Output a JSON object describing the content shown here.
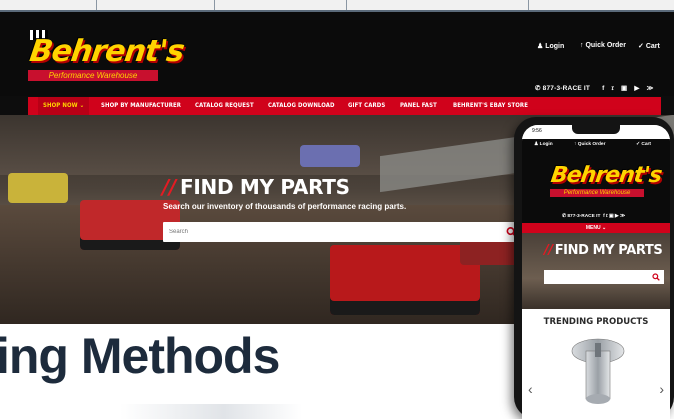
{
  "desktop": {
    "brand": {
      "name": "Behrent's",
      "tagline": "Performance Warehouse"
    },
    "util": {
      "login": "Login",
      "quick_order": "Quick Order",
      "cart": "Cart"
    },
    "phone_line": "877-3-RACE IT",
    "social_icons": [
      "facebook-icon",
      "twitter-icon",
      "instagram-icon",
      "youtube-icon",
      "rss-icon"
    ],
    "nav": [
      {
        "label": "SHOP NOW",
        "active": true
      },
      {
        "label": "SHOP BY MANUFACTURER"
      },
      {
        "label": "CATALOG REQUEST"
      },
      {
        "label": "CATALOG DOWNLOAD"
      },
      {
        "label": "GIFT CARDS"
      },
      {
        "label": "PANEL FAST"
      },
      {
        "label": "BEHRENT'S EBAY STORE"
      }
    ],
    "hero": {
      "title": "FIND MY PARTS",
      "subtitle": "Search our inventory of thousands of performance racing parts.",
      "search_placeholder": "Search"
    }
  },
  "mobile": {
    "status_time": "9:56",
    "util": {
      "login": "Login",
      "quick_order": "Quick Order",
      "cart": "Cart"
    },
    "phone_line": "877-3-RACE IT",
    "menu_label": "MENU",
    "hero_title": "FIND MY PARTS",
    "trending_title": "TRENDING PRODUCTS"
  },
  "headline": "ing Methods",
  "colors": {
    "brand_red": "#d0021b",
    "brand_yellow": "#ffd400",
    "headline_navy": "#1d2b3c"
  }
}
